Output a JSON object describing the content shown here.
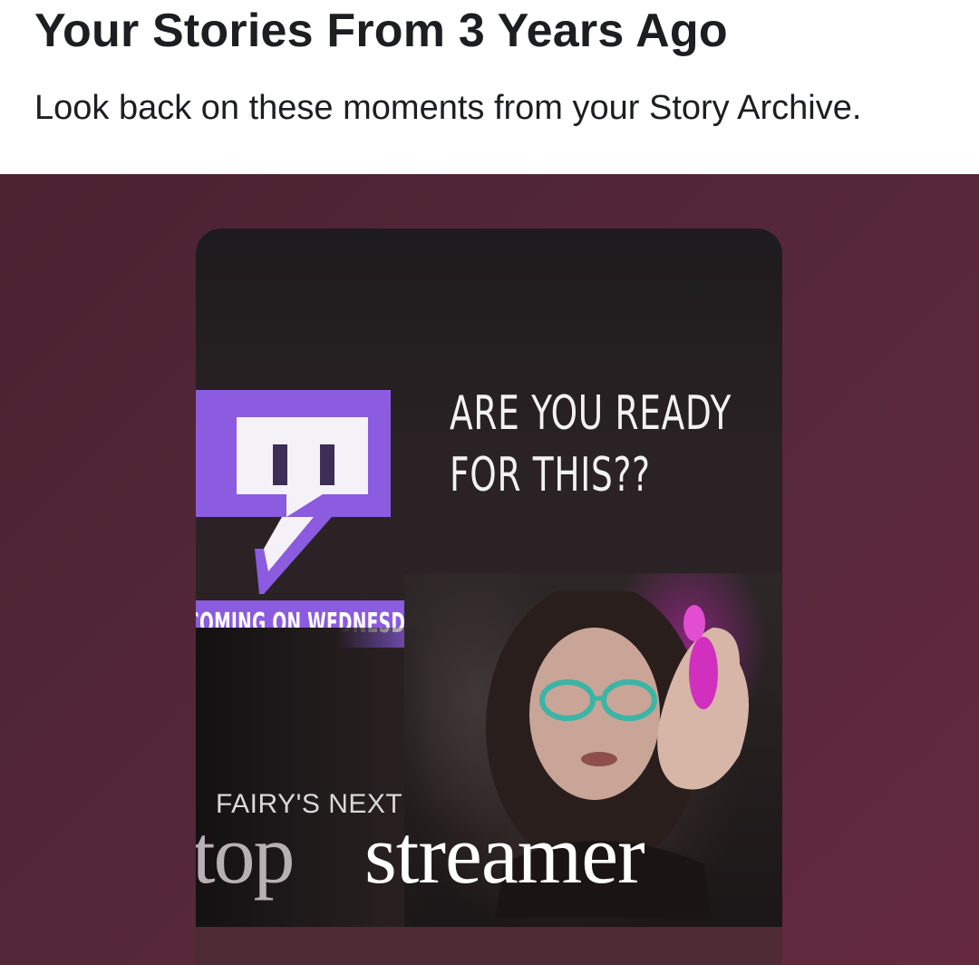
{
  "header": {
    "title": "Your Stories From 3 Years Ago",
    "subtitle": "Look back on these moments from your Story Archive."
  },
  "story": {
    "headline_line1": "ARE YOU READY",
    "headline_line2": "FOR THIS??",
    "banner": "COMING ON WEDNESDAY",
    "caption_small": "FAIRY'S NEXT",
    "caption_top": "top",
    "caption_streamer": "streamer",
    "logo": "twitch-glitch-logo",
    "accent_color": "#8b5be0",
    "background_color": "#56283a"
  }
}
